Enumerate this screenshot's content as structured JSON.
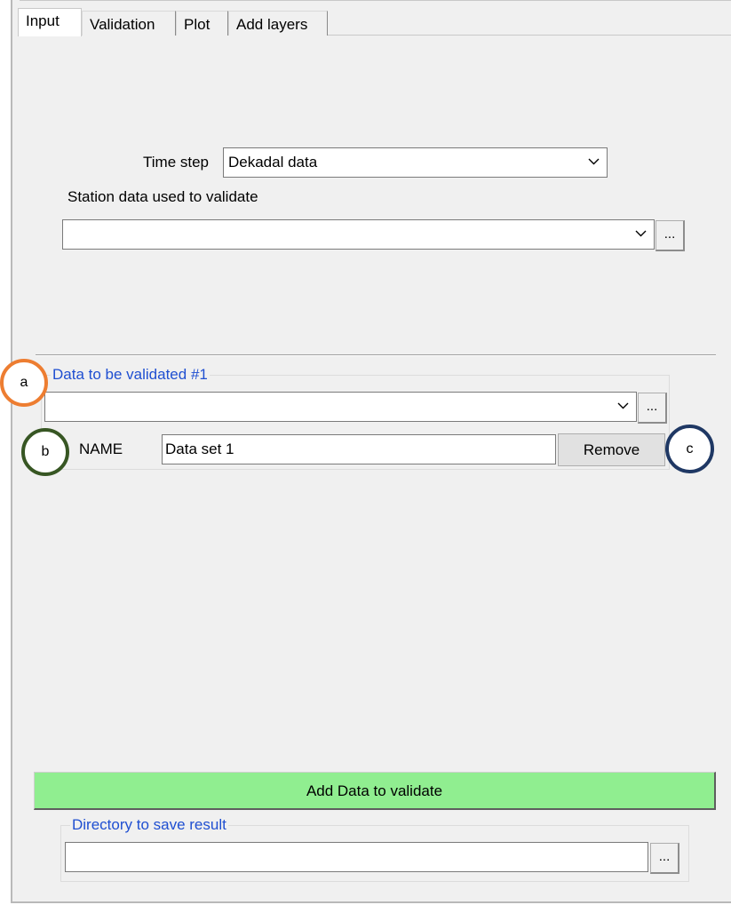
{
  "tabs": [
    "Input",
    "Validation",
    "Plot",
    "Add layers"
  ],
  "time_step": {
    "label": "Time step",
    "value": "Dekadal data"
  },
  "station": {
    "label": "Station data used to validate",
    "value": "",
    "browse_label": "..."
  },
  "data_group": {
    "legend": "Data to be validated #1",
    "combo_value": "",
    "browse_label": "...",
    "name_label": "NAME",
    "name_value": "Data set 1",
    "remove_label": "Remove"
  },
  "add_button_label": "Add Data to validate",
  "directory": {
    "legend": "Directory to save result",
    "value": "",
    "browse_label": "..."
  },
  "annotations": [
    {
      "letter": "a",
      "color": "#ed7d31"
    },
    {
      "letter": "b",
      "color": "#375623"
    },
    {
      "letter": "c",
      "color": "#1f3864"
    }
  ],
  "colors": {
    "add_button": "#90ee90",
    "group_legend": "#1f4fd1"
  },
  "icons": [
    "chevron-down-icon"
  ]
}
